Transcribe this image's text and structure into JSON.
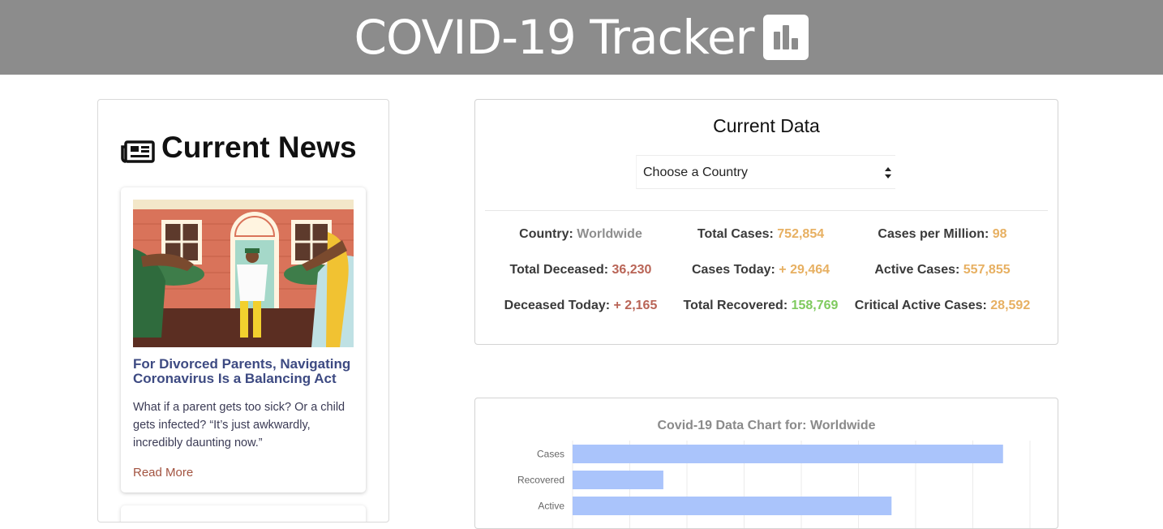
{
  "header": {
    "title": "COVID-19 Tracker",
    "icon": "bar-chart-icon"
  },
  "news": {
    "heading": "Current News",
    "heading_icon": "newspaper-icon",
    "articles": [
      {
        "title": "For Divorced Parents, Navigating Coronavirus Is a Balancing Act",
        "description": "What if a parent gets too sick? Or a child gets infected? “It’s just awkwardly, incredibly daunting now.”",
        "read_more": "Read More"
      }
    ]
  },
  "current_data": {
    "title": "Current Data",
    "country_select": {
      "selected": "Choose a Country"
    },
    "stats": {
      "country": {
        "label": "Country:",
        "value": "Worldwide"
      },
      "total_cases": {
        "label": "Total Cases:",
        "value": "752,854"
      },
      "cases_per_million": {
        "label": "Cases per Million:",
        "value": "98"
      },
      "total_deceased": {
        "label": "Total Deceased:",
        "value": "36,230"
      },
      "cases_today": {
        "label": "Cases Today:",
        "value": "+ 29,464"
      },
      "active_cases": {
        "label": "Active Cases:",
        "value": "557,855"
      },
      "deceased_today": {
        "label": "Deceased Today:",
        "value": "+ 2,165"
      },
      "total_recovered": {
        "label": "Total Recovered:",
        "value": "158,769"
      },
      "critical_active": {
        "label": "Critical Active Cases:",
        "value": "28,592"
      }
    },
    "colors": {
      "gray": "#8e8e8e",
      "orange": "#e7b062",
      "red": "#b96456",
      "green": "#7fca5e"
    }
  },
  "chart_panel": {
    "title": "Covid-19 Data Chart for: Worldwide"
  },
  "chart_data": {
    "type": "bar",
    "orientation": "horizontal",
    "title": "Covid-19 Data Chart for: Worldwide",
    "categories": [
      "Cases",
      "Recovered",
      "Active"
    ],
    "values": [
      752854,
      158769,
      557855
    ],
    "bar_color": "#aac4fb",
    "grid": true
  }
}
